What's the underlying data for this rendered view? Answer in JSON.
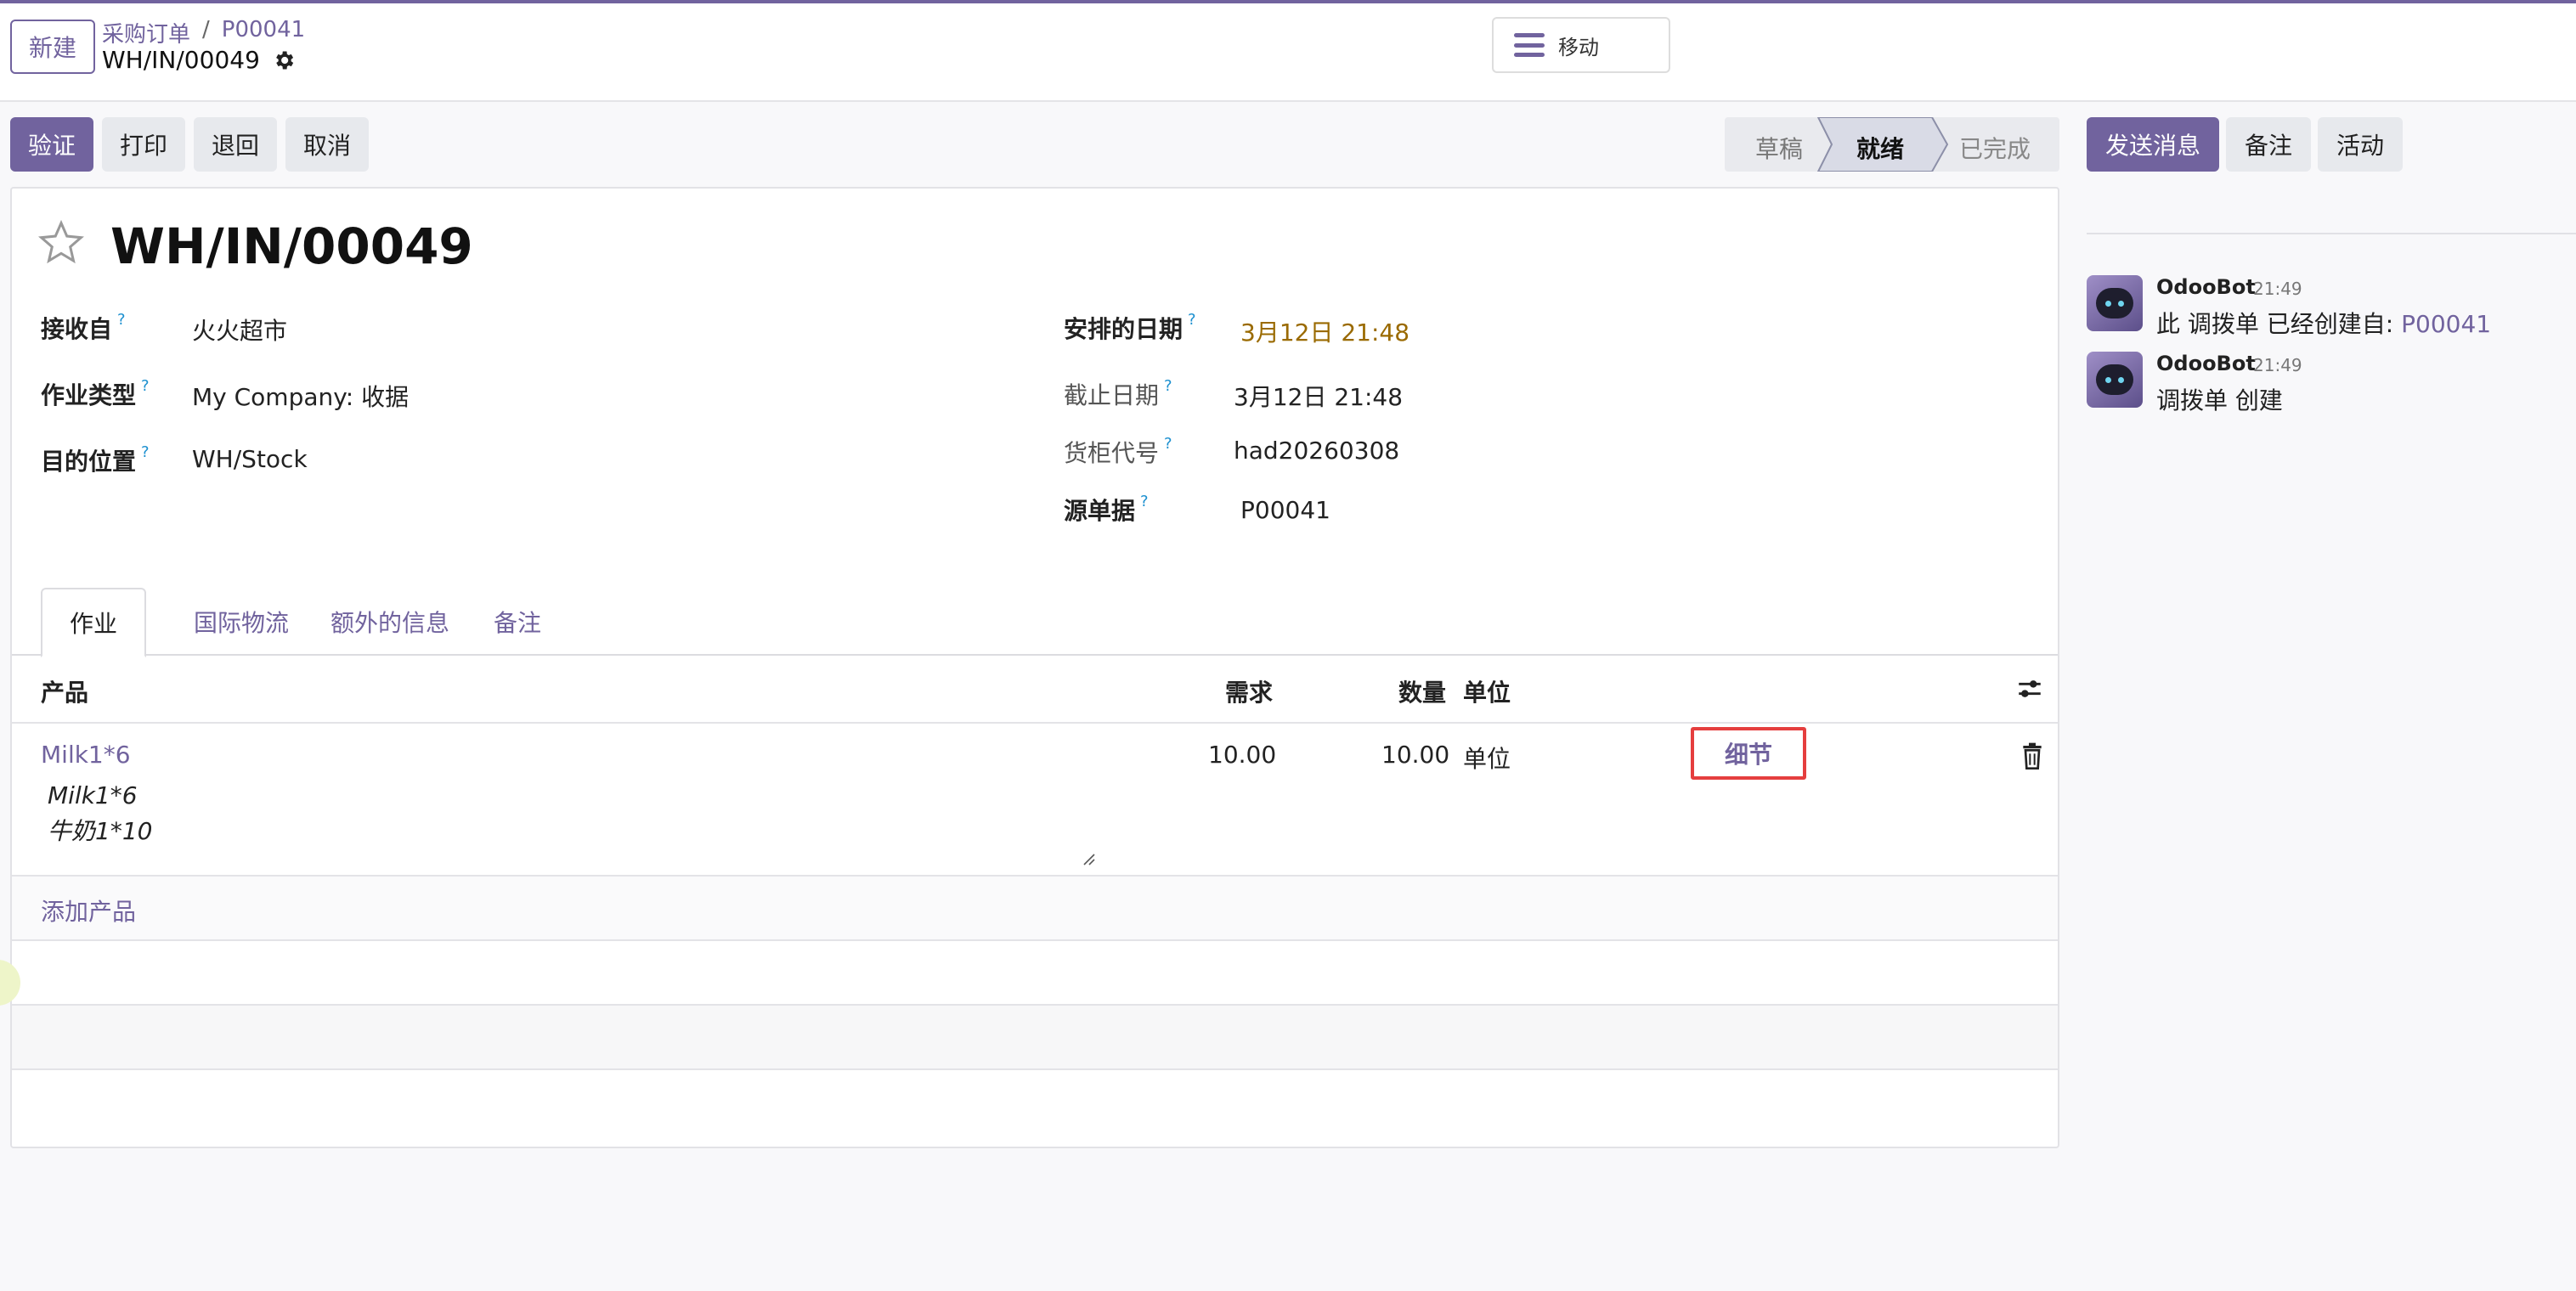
{
  "control_panel": {
    "new_button": "新建",
    "breadcrumb": [
      "采购订单",
      "P00041"
    ],
    "breadcrumb_sep": "/",
    "record_name": "WH/IN/00049",
    "move_button": "移动"
  },
  "status_bar": {
    "buttons": [
      "验证",
      "打印",
      "退回",
      "取消"
    ],
    "stages": [
      "草稿",
      "就绪",
      "已完成"
    ],
    "active_stage": "就绪"
  },
  "chatter_buttons": [
    "发送消息",
    "备注",
    "活动"
  ],
  "form": {
    "title": "WH/IN/00049",
    "left_fields": [
      {
        "label": "接收自",
        "value": "火火超市"
      },
      {
        "label": "作业类型",
        "value": "My Company: 收据"
      },
      {
        "label": "目的位置",
        "value": "WH/Stock"
      }
    ],
    "right_fields": [
      {
        "label": "安排的日期",
        "value": "3月12日 21:48"
      },
      {
        "label": "截止日期",
        "value": "3月12日 21:48"
      },
      {
        "label": "货柜代号",
        "value": "had20260308"
      },
      {
        "label": "源单据",
        "value": "P00041"
      }
    ],
    "help_mark": "?",
    "tabs": [
      "作业",
      "国际物流",
      "额外的信息",
      "备注"
    ],
    "table": {
      "columns": [
        "产品",
        "需求",
        "数量",
        "单位"
      ],
      "rows": [
        {
          "product": "Milk1*6",
          "description": [
            "Milk1*6",
            "牛奶1*10"
          ],
          "demand": "10.00",
          "quantity": "10.00",
          "uom": "单位",
          "detail_button": "细节"
        }
      ],
      "add_product": "添加产品"
    }
  },
  "chatter": {
    "messages": [
      {
        "author": "OdooBot",
        "time": "21:49",
        "text": "此 调拨单 已经创建自: ",
        "link": "P00041"
      },
      {
        "author": "OdooBot",
        "time": "21:49",
        "text": "调拨单 创建",
        "link": ""
      }
    ]
  },
  "colors": {
    "primary": "#71639e",
    "warning_date": "#9a6a00",
    "highlight_border": "#e53e3e",
    "help": "#1a8fcf"
  },
  "icons": [
    "gear-icon",
    "menu-icon",
    "star-icon",
    "optional-columns-icon",
    "trash-icon",
    "odoobot-avatar"
  ]
}
